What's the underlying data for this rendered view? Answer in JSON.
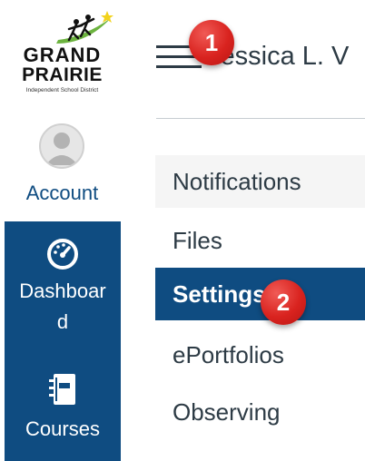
{
  "logo": {
    "line1": "GRAND",
    "line2": "PRAIRIE",
    "subtitle": "Independent School District"
  },
  "global_nav": {
    "account_label": "Account",
    "dashboard_label_line1": "Dashboar",
    "dashboard_label_line2": "d",
    "courses_label": "Courses",
    "active_color": "#0f4c81"
  },
  "header": {
    "user_name": "Jessica L. V"
  },
  "account_menu": {
    "items": [
      {
        "label": "Notifications"
      },
      {
        "label": "Files"
      },
      {
        "label": "Settings",
        "selected": true
      },
      {
        "label": "ePortfolios"
      },
      {
        "label": "Observing"
      }
    ]
  },
  "callouts": {
    "step1": "1",
    "step2": "2",
    "color": "#d9231f"
  },
  "icons": [
    "logo-icon",
    "avatar-icon",
    "dashboard-icon",
    "courses-icon",
    "hamburger-menu-icon"
  ]
}
